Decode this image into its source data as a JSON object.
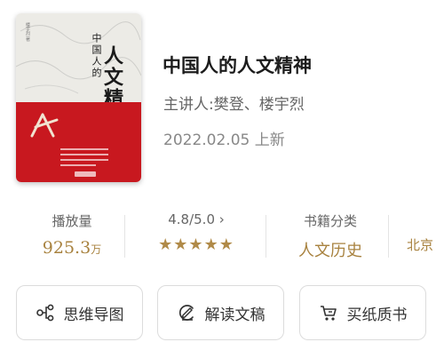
{
  "book": {
    "title": "中国人的人文精神",
    "speaker": "主讲人:樊登、楼宇烈",
    "date": "2022.02.05 上新",
    "cover": {
      "title_chars_1": "中国人的",
      "title_chars_2": "人文精神",
      "author": "楼宇烈 著",
      "colors": {
        "top": "#ecebe6",
        "bottom": "#c8181f"
      }
    }
  },
  "stats": {
    "plays": {
      "label": "播放量",
      "value": "925.3",
      "unit": "万"
    },
    "rating": {
      "label": "4.8/5.0",
      "chevron": "›",
      "stars": "★★★★★",
      "score": 4.8,
      "max": 5.0
    },
    "category": {
      "label": "书籍分类",
      "value": "人文历史"
    },
    "extra": {
      "value": "北京"
    }
  },
  "buttons": {
    "mindmap": {
      "label": "思维导图",
      "icon": "share-nodes-icon"
    },
    "interpret": {
      "label": "解读文稿",
      "icon": "pen-doc-icon"
    },
    "buy": {
      "label": "买纸质书",
      "icon": "cart-icon"
    }
  },
  "colors": {
    "accent": "#a8823f",
    "text_muted": "#666666"
  }
}
